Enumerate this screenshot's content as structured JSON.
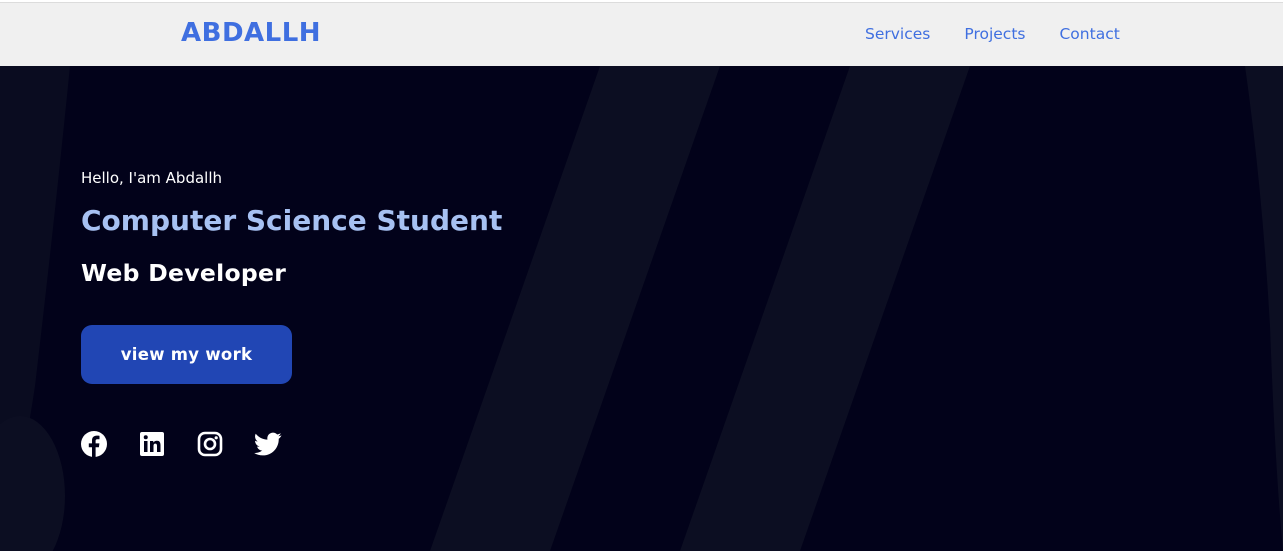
{
  "header": {
    "logo": "ABDALLH",
    "nav": [
      "Services",
      "Projects",
      "Contact"
    ]
  },
  "hero": {
    "greeting": "Hello, I'am Abdallh",
    "title": "Computer Science Student",
    "subtitle": "Web Developer",
    "cta_label": "view my work",
    "socials": [
      "facebook-icon",
      "linkedin-icon",
      "instagram-icon",
      "twitter-icon"
    ]
  },
  "colors": {
    "accent": "#3f6fe0",
    "hero_bg": "#02021a",
    "title": "#a7c1f2",
    "button": "#2146b4",
    "navbar_bg": "#f0f0f0"
  }
}
